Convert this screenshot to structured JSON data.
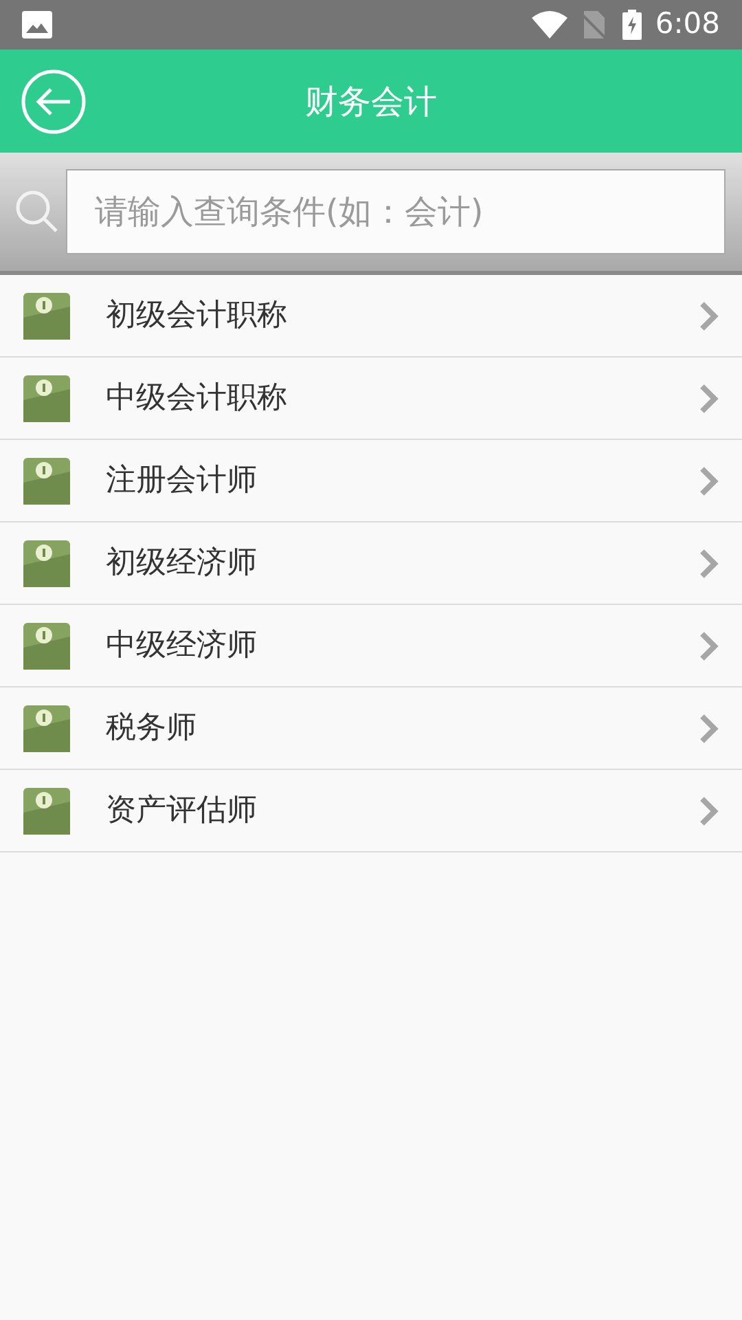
{
  "status_bar": {
    "time": "6:08"
  },
  "header": {
    "title": "财务会计"
  },
  "search": {
    "placeholder": "请输入查询条件(如：会计)"
  },
  "items": [
    {
      "label": "初级会计职称"
    },
    {
      "label": "中级会计职称"
    },
    {
      "label": "注册会计师"
    },
    {
      "label": "初级经济师"
    },
    {
      "label": "中级经济师"
    },
    {
      "label": "税务师"
    },
    {
      "label": "资产评估师"
    }
  ]
}
